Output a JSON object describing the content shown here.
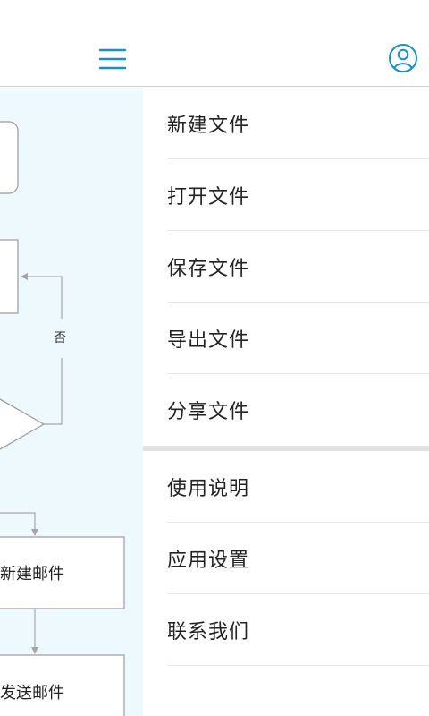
{
  "header": {
    "menu_icon": "hamburger-menu-icon",
    "account_icon": "user-account-icon",
    "accent_color": "#1a8ec6"
  },
  "canvas": {
    "background": "#eef9fd",
    "branch_label": "否",
    "nodes": {
      "new_mail": "新建邮件",
      "send_mail": "发送邮件"
    }
  },
  "drawer": {
    "file_items": [
      {
        "label": "新建文件"
      },
      {
        "label": "打开文件"
      },
      {
        "label": "保存文件"
      },
      {
        "label": "导出文件"
      },
      {
        "label": "分享文件"
      }
    ],
    "app_items": [
      {
        "label": "使用说明"
      },
      {
        "label": "应用设置"
      },
      {
        "label": "联系我们"
      }
    ]
  }
}
